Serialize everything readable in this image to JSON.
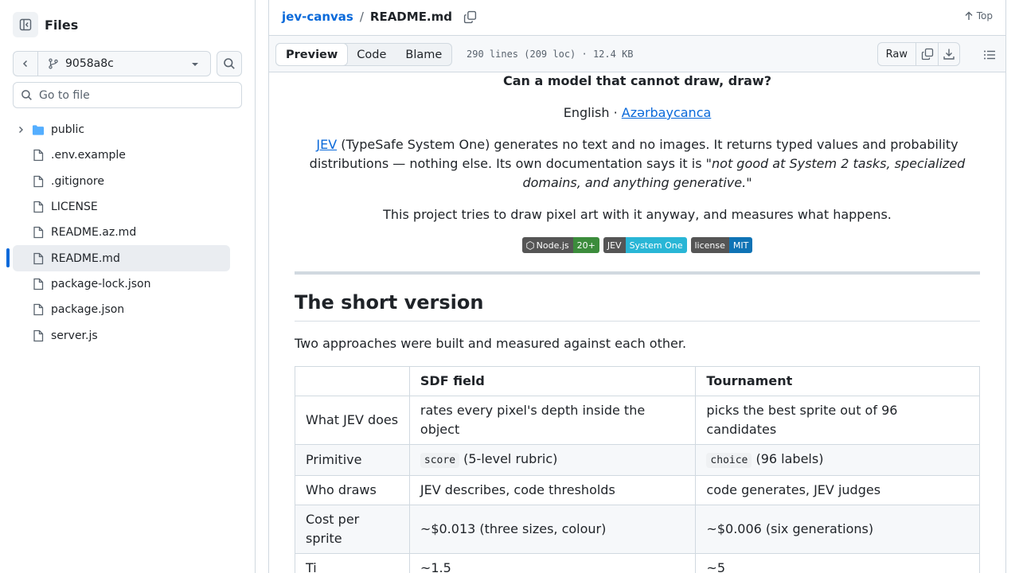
{
  "sidebar": {
    "title": "Files",
    "branch": "9058a8c",
    "goto_placeholder": "Go to file",
    "items": [
      {
        "label": "public",
        "type": "folder"
      },
      {
        "label": ".env.example",
        "type": "file"
      },
      {
        "label": ".gitignore",
        "type": "file"
      },
      {
        "label": "LICENSE",
        "type": "file"
      },
      {
        "label": "README.az.md",
        "type": "file"
      },
      {
        "label": "README.md",
        "type": "file",
        "active": true
      },
      {
        "label": "package-lock.json",
        "type": "file"
      },
      {
        "label": "package.json",
        "type": "file"
      },
      {
        "label": "server.js",
        "type": "file"
      }
    ]
  },
  "header": {
    "repo": "jev-canvas",
    "separator": "/",
    "file": "README.md",
    "top_label": "Top"
  },
  "toolbar": {
    "tabs": [
      "Preview",
      "Code",
      "Blame"
    ],
    "active_tab": "Preview",
    "meta": "290 lines (209 loc) · 12.4 KB",
    "raw_label": "Raw"
  },
  "readme": {
    "tagline": "Can a model that cannot draw, draw?",
    "lang_current": "English",
    "lang_sep": " · ",
    "lang_other": "Azərbaycanca",
    "intro_link": "JEV",
    "intro_text": " (TypeSafe System One) generates no text and no images. It returns typed values and probability distributions — nothing else. Its own documentation says it is ",
    "intro_quote": "\"not good at System 2 tasks, specialized domains, and anything generative.\"",
    "tries": "This project tries to draw pixel art with it anyway, and measures what happens.",
    "badges": {
      "node_label": "Node.js",
      "node_value": "20+",
      "jev_label": "JEV",
      "jev_value": "System One",
      "license_label": "license",
      "license_value": "MIT"
    },
    "section_title": "The short version",
    "section_para": "Two approaches were built and measured against each other.",
    "table": {
      "headers": [
        "",
        "SDF field",
        "Tournament"
      ],
      "rows": [
        {
          "label": "What JEV does",
          "a": "rates every pixel's depth inside the object",
          "b": "picks the best sprite out of 96 candidates"
        },
        {
          "label": "Primitive",
          "a_code": "score",
          "a": " (5-level rubric)",
          "b_code": "choice",
          "b": " (96 labels)"
        },
        {
          "label": "Who draws",
          "a": "JEV describes, code thresholds",
          "b": "code generates, JEV judges"
        },
        {
          "label": "Cost per sprite",
          "a": "~$0.013 (three sizes, colour)",
          "b": "~$0.006 (six generations)"
        },
        {
          "label": "Ti",
          "a": "~1.5",
          "b": "~5"
        }
      ]
    }
  },
  "colors": {
    "link": "#0969da",
    "active_bar": "#0969da",
    "folder": "#54aeff"
  }
}
